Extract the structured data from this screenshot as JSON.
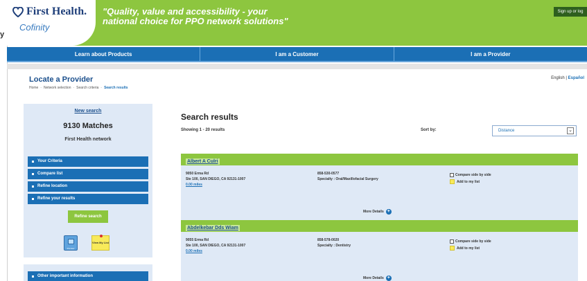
{
  "header": {
    "brand": "First Health.",
    "sub_brand": "Cofinity",
    "tagline": "\"Quality, value and accessibility - your national choice for PPO network solutions\"",
    "signup": "Sign up or log",
    "stray_mark": "y"
  },
  "nav": {
    "items": [
      "Learn about Products",
      "I am a Customer",
      "I am a Provider"
    ]
  },
  "page": {
    "title": "Locate a Provider",
    "breadcrumb": [
      "Home",
      "Network selection",
      "Search criteria",
      "Search results"
    ],
    "lang_en": "English |",
    "lang_es": "Español"
  },
  "sidebar": {
    "new_search": "New search",
    "matches": "9130 Matches",
    "network": "First Health network",
    "menu": [
      "Your Criteria",
      "Compare list",
      "Refine location",
      "Refine your results"
    ],
    "refine_button": "Refine search",
    "tool_icon_1": "Preview",
    "tool_icon_2": "View My List",
    "other_info": "Other important information"
  },
  "results": {
    "title": "Search results",
    "showing": "Showing 1 - 20 results",
    "sortby_label": "Sort by:",
    "sort_value": "Distance",
    "items": [
      {
        "name": "Albert A Culri",
        "address1": "9050 Erma Rd",
        "address2": "Ste 100, SAN DIEGO, CA 92131-1007",
        "miles": "0.00 miles",
        "phone": "858-530-0577",
        "specialty": "Specialty : Oral/Maxillofacial Surgery",
        "compare": "Compare side by side",
        "add_list": "Add to my list",
        "more": "More Details"
      },
      {
        "name": "Abdelkebar Dds Wiam",
        "address1": "9055 Erma Rd",
        "address2": "Ste 100, SAN DIEGO, CA 92131-1007",
        "miles": "0.00 miles",
        "phone": "858-578-0020",
        "specialty": "Specialty : Dentistry",
        "compare": "Compare side by side",
        "add_list": "Add to my list",
        "more": "More Details"
      }
    ]
  }
}
